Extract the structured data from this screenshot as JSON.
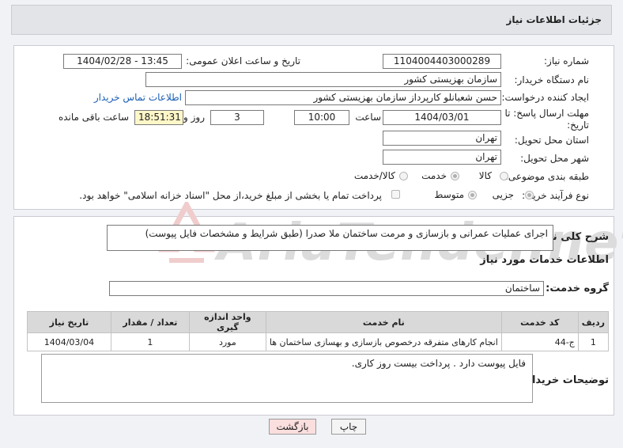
{
  "header": {
    "title": "جزئیات اطلاعات نیاز"
  },
  "form": {
    "need_number_label": "شماره نیاز:",
    "need_number": "1104004403000289",
    "announce_label": "تاریخ و ساعت اعلان عمومی:",
    "announce_value": "1404/02/28 - 13:45",
    "buyer_org_label": "نام دستگاه خریدار:",
    "buyer_org": "سازمان بهزیستی کشور",
    "requester_label": "ایجاد کننده درخواست:",
    "requester": "حسن  شعبانلو کارپرداز سازمان بهزیستی کشور",
    "contact_link": "اطلاعات تماس خریدار",
    "deadline_label_1": "مهلت ارسال پاسخ: تا",
    "deadline_label_2": "تاریخ:",
    "deadline_date": "1404/03/01",
    "time_label": "ساعت",
    "deadline_time": "10:00",
    "days_value": "3",
    "days_label": "روز و",
    "remaining_time": "18:51:31",
    "remaining_label": "ساعت باقی مانده",
    "province_label": "استان محل تحویل:",
    "province": "تهران",
    "city_label": "شهر محل تحویل:",
    "city": "تهران",
    "category_label": "طبقه بندی موضوعی:",
    "category_options": [
      "کالا",
      "خدمت",
      "کالا/خدمت"
    ],
    "category_selected": "خدمت",
    "process_label": "نوع فرآیند خرید :",
    "process_options": [
      "جزیی",
      "متوسط"
    ],
    "process_selected": "جزیی",
    "payment_note": "پرداخت تمام یا بخشی از مبلغ خرید،از محل \"اسناد خزانه اسلامی\" خواهد بود."
  },
  "description": {
    "label": "شرح کلی نیاز:",
    "value": "اجرای عملیات عمرانی و بازسازی و مرمت ساختمان ملا صدرا  (طبق شرایط و مشخصات فایل پیوست)"
  },
  "services": {
    "section_title": "اطلاعات خدمات مورد نیاز",
    "group_label": "گروه خدمت:",
    "group_value": "ساختمان",
    "columns": [
      "ردیف",
      "کد خدمت",
      "نام خدمت",
      "واحد اندازه گیری",
      "تعداد / مقدار",
      "تاریخ نیاز"
    ],
    "rows": [
      [
        "1",
        "ج-44",
        "انجام کارهای متفرقه درخصوص بازسازی و بهسازی ساختمان ها",
        "مورد",
        "1",
        "1404/03/04"
      ]
    ]
  },
  "buyer_notes": {
    "label": "توضیحات خریدار:",
    "value": "فایل پیوست دارد . پرداخت بیست روز کاری."
  },
  "buttons": {
    "print": "چاپ",
    "back": "بازگشت"
  },
  "watermark": "AriaTender.net"
}
